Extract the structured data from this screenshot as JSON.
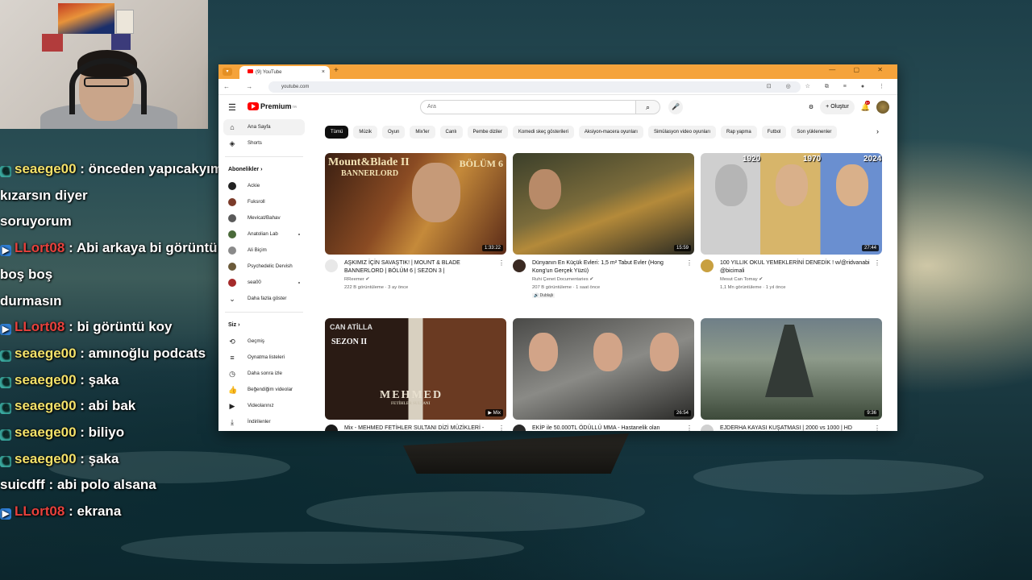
{
  "chat": [
    {
      "badge": "g",
      "user": "seaege00",
      "user_color": "y",
      "message": " : önceden yapıcakyım kızarsın diyer"
    },
    {
      "badge": "",
      "user": "",
      "user_color": "w",
      "message": "soruyorum"
    },
    {
      "badge": "b",
      "user": "LLort08",
      "user_color": "r",
      "message": " : Abi arkaya bi görüntü koy bari boş boş"
    },
    {
      "badge": "",
      "user": "",
      "user_color": "w",
      "message": "durmasın"
    },
    {
      "badge": "b",
      "user": "LLort08",
      "user_color": "r",
      "message": " : bi görüntü koy"
    },
    {
      "badge": "g",
      "user": "seaege00",
      "user_color": "y",
      "message": " : amınoğlu podcats"
    },
    {
      "badge": "g",
      "user": "seaege00",
      "user_color": "y",
      "message": " : şaka"
    },
    {
      "badge": "g",
      "user": "seaege00",
      "user_color": "y",
      "message": " : abi bak"
    },
    {
      "badge": "g",
      "user": "seaege00",
      "user_color": "y",
      "message": " : biliyo"
    },
    {
      "badge": "g",
      "user": "seaege00",
      "user_color": "y",
      "message": " : şaka"
    },
    {
      "badge": "",
      "user": "suicdff",
      "user_color": "w",
      "message": " : abi polo alsana"
    },
    {
      "badge": "b",
      "user": "LLort08",
      "user_color": "r",
      "message": " : ekrana"
    }
  ],
  "browser": {
    "tab_title": "(9) YouTube",
    "tab_close": "×",
    "new_tab": "+",
    "window_buttons": "—  ▢  ✕",
    "url": "youtube.com",
    "nav": "← → ⟳",
    "toolbar_icons": "⊡ ◎ ☆ ⧉ ≡ ● ⋮"
  },
  "yt": {
    "logo": "Premium",
    "logo_sup": "TR",
    "search_placeholder": "Ara",
    "search_icon": "⌕",
    "mic_icon": "🎤",
    "create_label": "Oluştur",
    "bell_badge": "9+",
    "cast_icon": "⚙",
    "bell_icon": "🔔",
    "hamburger": "☰"
  },
  "sidebar": {
    "home": "Ana Sayfa",
    "shorts": "Shorts",
    "subs_head": "Abonelikler",
    "subscriptions": [
      {
        "name": "Ackie",
        "color": "#222",
        "dot": false
      },
      {
        "name": "Fuksroll",
        "color": "#7b3b2a",
        "dot": false
      },
      {
        "name": "Mevicat/Bahav",
        "color": "#5a5a5a",
        "dot": false
      },
      {
        "name": "Anatolian Lab",
        "color": "#4a6a3a",
        "dot": true
      },
      {
        "name": "Ali Biçim",
        "color": "#8a8a8a",
        "dot": false
      },
      {
        "name": "Psychedelic Dervish",
        "color": "#6b5a3a",
        "dot": false
      },
      {
        "name": "sea00",
        "color": "#a52a2a",
        "dot": true
      }
    ],
    "show_more": "Daha fazla göster",
    "you_head": "Siz",
    "you_items": [
      {
        "label": "Geçmiş",
        "icon": "⟲"
      },
      {
        "label": "Oynatma listeleri",
        "icon": "≡"
      },
      {
        "label": "Daha sonra izle",
        "icon": "◷"
      },
      {
        "label": "Beğendiğim videolar",
        "icon": "👍"
      },
      {
        "label": "Videolarınız",
        "icon": "▶"
      },
      {
        "label": "İndirilenler",
        "icon": "⤓"
      }
    ]
  },
  "chips": [
    "Tümü",
    "Müzik",
    "Oyun",
    "Mix'ler",
    "Canlı",
    "Pembe diziler",
    "Komedi skeç gösterileri",
    "Aksiyon-macera oyunları",
    "Simülasyon video oyunları",
    "Rap yapma",
    "Futbol",
    "Son yüklenenler"
  ],
  "videos": [
    {
      "title": "AŞKIMIZ İÇİN SAVAŞTIK! | MOUNT & BLADE BANNERLORD | BÖLÜM 6 | SEZON 3 |",
      "channel": "RReemer ✔",
      "stats": "222 B görüntüleme · 3 ay önce",
      "duration": "1:33:22",
      "dub": "",
      "thumb_title": "Mount&Blade II",
      "thumb_sub": "BANNERLORD",
      "thumb_extra": "BÖLÜM 6"
    },
    {
      "title": "Dünyanın En Küçük Evleri: 1,5 m² Tabut Evler (Hong Kong'un Gerçek Yüzü)",
      "channel": "Ruhi Çenet Documentaries ✔",
      "stats": "207 B görüntüleme · 1 saat önce",
      "duration": "15:59",
      "dub": "🔊 Dublajlı",
      "thumb_title": "",
      "thumb_sub": "",
      "thumb_extra": ""
    },
    {
      "title": "100 YILLIK OKUL YEMEKLERİNİ DENEDİK ! w/@ridvanabi @bicimali",
      "channel": "Mesut Can Tomay ✔",
      "stats": "1,1 Mn görüntüleme · 1 yıl önce",
      "duration": "27:44",
      "dub": "",
      "thumb_title": "",
      "thumb_sub": "",
      "thumb_extra": "",
      "years": [
        "1920",
        "1970",
        "2024"
      ]
    },
    {
      "title": "Mix - MEHMED FETİHLER SULTANI DİZİ MÜZİKLERİ -",
      "channel": "",
      "stats": "",
      "duration": "▶ Mix",
      "dub": "",
      "thumb_title": "CAN ATİLLA",
      "thumb_sub": "SEZON II",
      "thumb_extra": "MEHMED",
      "thumb_extra2": "FETİHLER SULTANI"
    },
    {
      "title": "EKİP ile 50.000TL ÖDÜLLÜ MMA - Hastanelik olan",
      "channel": "",
      "stats": "",
      "duration": "26:54",
      "dub": "",
      "thumb_title": "",
      "thumb_sub": "",
      "thumb_extra": ""
    },
    {
      "title": "EJDERHA KAYASI KUŞATMASI | 2000 vs 1000 | HD",
      "channel": "",
      "stats": "",
      "duration": "9:36",
      "dub": "",
      "thumb_title": "",
      "thumb_sub": "",
      "thumb_extra": ""
    }
  ],
  "kebab": "⋮",
  "chip_next": "›"
}
